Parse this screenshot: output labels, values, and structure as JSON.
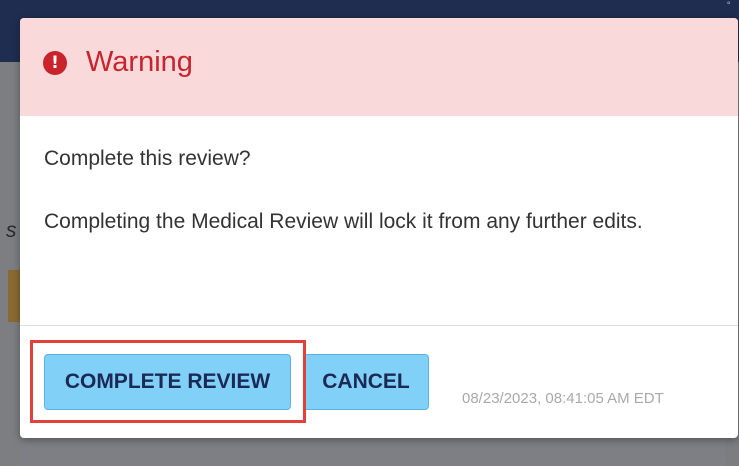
{
  "backdrop": {
    "left_letter": "s",
    "topbar_glyph": "˚"
  },
  "dialog": {
    "icon": "exclamation-circle-icon",
    "icon_glyph": "!",
    "title": "Warning",
    "question": "Complete this review?",
    "message": "Completing the Medical Review will lock it from any further edits.",
    "complete_button_label": "COMPLETE REVIEW",
    "cancel_button_label": "CANCEL",
    "timestamp": "08/23/2023, 08:41:05 AM EDT"
  },
  "colors": {
    "header_background": "#f9d9da",
    "warning_red": "#c9242c",
    "button_background": "#80d0f8",
    "button_text": "#1a2a55",
    "highlight_outline": "#e3403d"
  }
}
